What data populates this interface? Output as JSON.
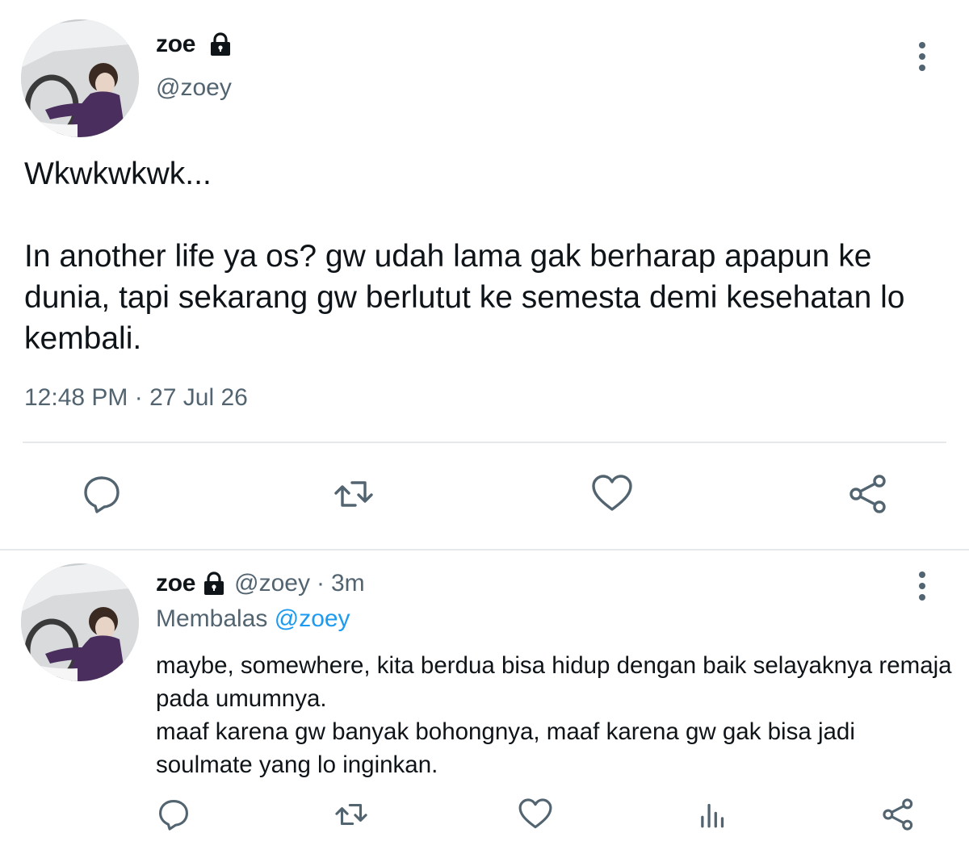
{
  "main_tweet": {
    "avatar_icon": "profile-photo",
    "display_name": "zoe",
    "lock_icon": "lock-icon",
    "handle": "@zoey",
    "text": "Wkwkwkwk...\n\nIn another life ya os? gw udah lama gak berharap apapun ke dunia, tapi sekarang gw berlutut ke semesta demi kesehatan lo kembali.",
    "timestamp": "12:48 PM · 27 Jul 26",
    "actions": [
      "reply-icon",
      "retweet-icon",
      "like-icon",
      "share-icon"
    ]
  },
  "reply_tweet": {
    "avatar_icon": "profile-photo",
    "display_name": "zoe",
    "lock_icon": "lock-icon",
    "handle": "@zoey",
    "separator": "·",
    "age": "3m",
    "replying_to_label": "Membalas",
    "replying_to_handle": "@zoey",
    "text": "maybe, somewhere, kita berdua bisa hidup dengan baik selayaknya remaja pada umumnya.\nmaaf karena gw banyak bohongnya, maaf karena gw gak bisa jadi soulmate yang lo inginkan.",
    "actions": [
      "reply-icon",
      "retweet-icon",
      "like-icon",
      "stats-icon",
      "share-icon"
    ]
  },
  "colors": {
    "text_primary": "#0f1419",
    "text_secondary": "#536471",
    "link": "#1d9bf0",
    "icon": "#536471",
    "divider": "#e6e9eb"
  }
}
